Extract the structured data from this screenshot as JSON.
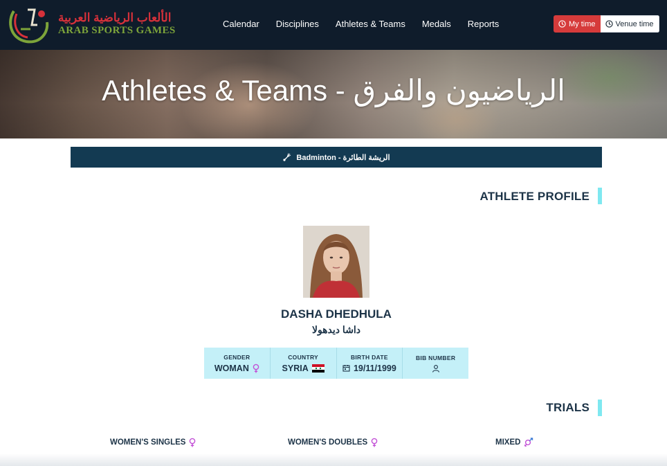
{
  "header": {
    "logo_arabic": "الألعاب الرياضية العربية",
    "logo_english": "ARAB SPORTS GAMES",
    "nav": [
      {
        "label": "Calendar"
      },
      {
        "label": "Disciplines"
      },
      {
        "label": "Athletes & Teams"
      },
      {
        "label": "Medals"
      },
      {
        "label": "Reports"
      }
    ],
    "time_toggle": {
      "my_time": "My time",
      "venue_time": "Venue time",
      "selected": "My time"
    }
  },
  "hero": {
    "title": "Athletes & Teams - الرياضيون والفرق"
  },
  "discipline": {
    "label": "Badminton - الريشة الطائرة",
    "icon": "badminton-icon"
  },
  "profile": {
    "section_title": "ATHLETE PROFILE",
    "name": "DASHA DHEDHULA",
    "name_arabic": "داشا ديدهولا",
    "gender_label": "GENDER",
    "gender_value": "WOMAN",
    "country_label": "COUNTRY",
    "country_value": "SYRIA",
    "birth_label": "BIRTH DATE",
    "birth_value": "19/11/1999",
    "bib_label": "BIB NUMBER"
  },
  "trials": {
    "section_title": "TRIALS",
    "items": [
      {
        "label": "WOMEN'S SINGLES",
        "icon": "female-icon"
      },
      {
        "label": "WOMEN'S DOUBLES",
        "icon": "female-icon"
      },
      {
        "label": "MIXED",
        "icon": "mixed-gender-icon"
      }
    ]
  },
  "colors": {
    "header_bg": "#0f1c2b",
    "accent_red": "#d63b3b",
    "discipline_bar": "#133a52",
    "info_strip": "#c4f0f8",
    "accent_cyan": "#7fe8f0",
    "female_pink": "#c24fd6"
  }
}
